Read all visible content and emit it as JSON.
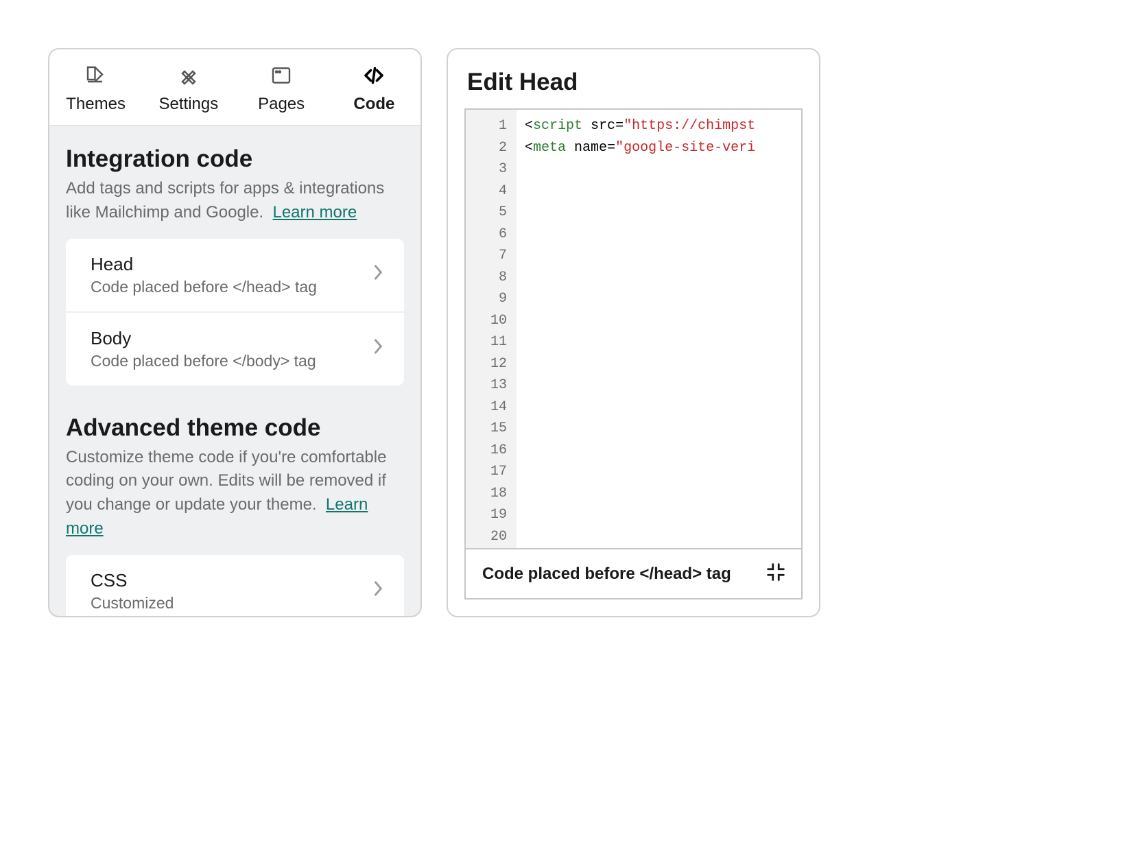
{
  "tabs": {
    "themes": "Themes",
    "settings": "Settings",
    "pages": "Pages",
    "code": "Code"
  },
  "section_integration": {
    "title": "Integration code",
    "desc": "Add tags and scripts for apps & integrations like Mailchimp and Google.",
    "learn_more": "Learn more",
    "items": [
      {
        "title": "Head",
        "sub": "Code placed before </head> tag"
      },
      {
        "title": "Body",
        "sub": "Code placed before </body> tag"
      }
    ]
  },
  "section_advanced": {
    "title": "Advanced theme code",
    "desc": "Customize theme code if you're comfortable coding on your own. Edits will be removed if you change or update your theme.",
    "learn_more": "Learn more",
    "items": [
      {
        "title": "CSS",
        "sub": "Customized"
      }
    ]
  },
  "editor": {
    "title": "Edit Head",
    "footer": "Code placed before </head> tag",
    "line_count": 20,
    "line1": {
      "tag": "script",
      "attr": "src",
      "value": "\"https://chimpst"
    },
    "line2": {
      "tag": "meta",
      "attr": "name",
      "value": "\"google-site-veri"
    }
  }
}
